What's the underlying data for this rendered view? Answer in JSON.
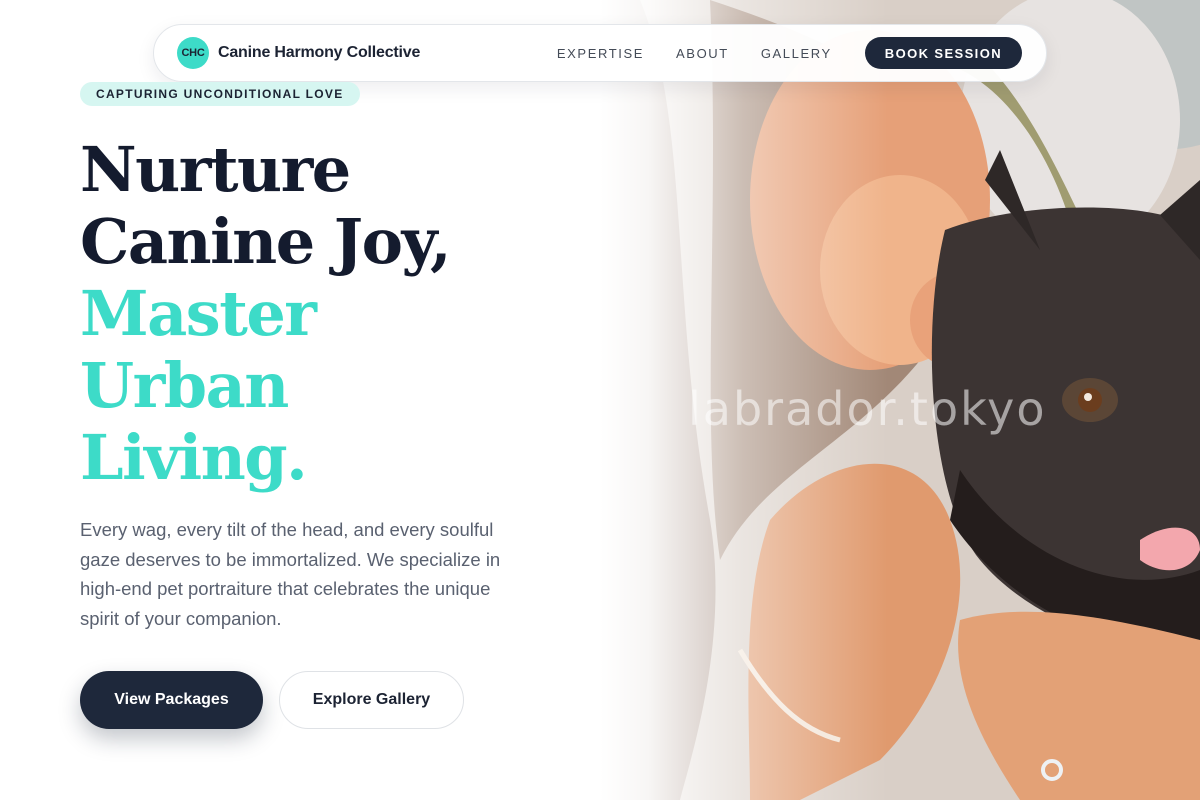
{
  "nav": {
    "logo_text": "CHC",
    "brand_name": "Canine Harmony Collective",
    "links": [
      "EXPERTISE",
      "ABOUT",
      "GALLERY"
    ],
    "cta_label": "BOOK SESSION"
  },
  "hero": {
    "tagline": "CAPTURING UNCONDITIONAL LOVE",
    "headline_dark": [
      "Nurture",
      "Canine Joy,"
    ],
    "headline_accent": [
      "Master",
      "Urban",
      "Living."
    ],
    "description": "Every wag, every tilt of the head, and every soulful gaze deserves to be immortalized. We specialize in high-end pet portraiture that celebrates the unique spirit of your companion.",
    "primary_button": "View Packages",
    "secondary_button": "Explore Gallery"
  },
  "image": {
    "watermark": "labrador.tokyo"
  },
  "colors": {
    "navy": "#1e283b",
    "teal": "#3ddbc8",
    "tagline_bg": "#d6f6f1",
    "body_text": "#5a6170"
  }
}
